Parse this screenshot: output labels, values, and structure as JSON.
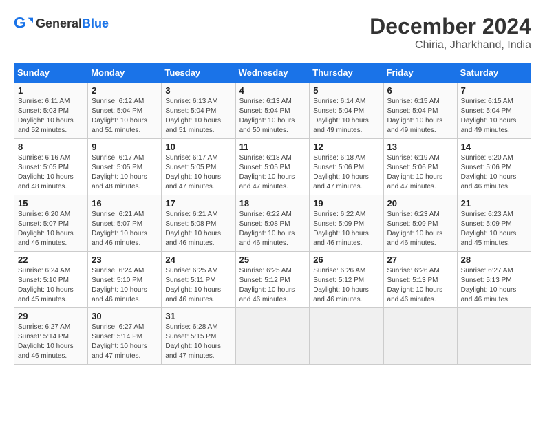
{
  "header": {
    "logo_general": "General",
    "logo_blue": "Blue",
    "main_title": "December 2024",
    "subtitle": "Chiria, Jharkhand, India"
  },
  "columns": [
    "Sunday",
    "Monday",
    "Tuesday",
    "Wednesday",
    "Thursday",
    "Friday",
    "Saturday"
  ],
  "weeks": [
    [
      {
        "day": "1",
        "info": "Sunrise: 6:11 AM\nSunset: 5:03 PM\nDaylight: 10 hours\nand 52 minutes."
      },
      {
        "day": "2",
        "info": "Sunrise: 6:12 AM\nSunset: 5:04 PM\nDaylight: 10 hours\nand 51 minutes."
      },
      {
        "day": "3",
        "info": "Sunrise: 6:13 AM\nSunset: 5:04 PM\nDaylight: 10 hours\nand 51 minutes."
      },
      {
        "day": "4",
        "info": "Sunrise: 6:13 AM\nSunset: 5:04 PM\nDaylight: 10 hours\nand 50 minutes."
      },
      {
        "day": "5",
        "info": "Sunrise: 6:14 AM\nSunset: 5:04 PM\nDaylight: 10 hours\nand 49 minutes."
      },
      {
        "day": "6",
        "info": "Sunrise: 6:15 AM\nSunset: 5:04 PM\nDaylight: 10 hours\nand 49 minutes."
      },
      {
        "day": "7",
        "info": "Sunrise: 6:15 AM\nSunset: 5:04 PM\nDaylight: 10 hours\nand 49 minutes."
      }
    ],
    [
      {
        "day": "8",
        "info": "Sunrise: 6:16 AM\nSunset: 5:05 PM\nDaylight: 10 hours\nand 48 minutes."
      },
      {
        "day": "9",
        "info": "Sunrise: 6:17 AM\nSunset: 5:05 PM\nDaylight: 10 hours\nand 48 minutes."
      },
      {
        "day": "10",
        "info": "Sunrise: 6:17 AM\nSunset: 5:05 PM\nDaylight: 10 hours\nand 47 minutes."
      },
      {
        "day": "11",
        "info": "Sunrise: 6:18 AM\nSunset: 5:05 PM\nDaylight: 10 hours\nand 47 minutes."
      },
      {
        "day": "12",
        "info": "Sunrise: 6:18 AM\nSunset: 5:06 PM\nDaylight: 10 hours\nand 47 minutes."
      },
      {
        "day": "13",
        "info": "Sunrise: 6:19 AM\nSunset: 5:06 PM\nDaylight: 10 hours\nand 47 minutes."
      },
      {
        "day": "14",
        "info": "Sunrise: 6:20 AM\nSunset: 5:06 PM\nDaylight: 10 hours\nand 46 minutes."
      }
    ],
    [
      {
        "day": "15",
        "info": "Sunrise: 6:20 AM\nSunset: 5:07 PM\nDaylight: 10 hours\nand 46 minutes."
      },
      {
        "day": "16",
        "info": "Sunrise: 6:21 AM\nSunset: 5:07 PM\nDaylight: 10 hours\nand 46 minutes."
      },
      {
        "day": "17",
        "info": "Sunrise: 6:21 AM\nSunset: 5:08 PM\nDaylight: 10 hours\nand 46 minutes."
      },
      {
        "day": "18",
        "info": "Sunrise: 6:22 AM\nSunset: 5:08 PM\nDaylight: 10 hours\nand 46 minutes."
      },
      {
        "day": "19",
        "info": "Sunrise: 6:22 AM\nSunset: 5:09 PM\nDaylight: 10 hours\nand 46 minutes."
      },
      {
        "day": "20",
        "info": "Sunrise: 6:23 AM\nSunset: 5:09 PM\nDaylight: 10 hours\nand 46 minutes."
      },
      {
        "day": "21",
        "info": "Sunrise: 6:23 AM\nSunset: 5:09 PM\nDaylight: 10 hours\nand 45 minutes."
      }
    ],
    [
      {
        "day": "22",
        "info": "Sunrise: 6:24 AM\nSunset: 5:10 PM\nDaylight: 10 hours\nand 45 minutes."
      },
      {
        "day": "23",
        "info": "Sunrise: 6:24 AM\nSunset: 5:10 PM\nDaylight: 10 hours\nand 46 minutes."
      },
      {
        "day": "24",
        "info": "Sunrise: 6:25 AM\nSunset: 5:11 PM\nDaylight: 10 hours\nand 46 minutes."
      },
      {
        "day": "25",
        "info": "Sunrise: 6:25 AM\nSunset: 5:12 PM\nDaylight: 10 hours\nand 46 minutes."
      },
      {
        "day": "26",
        "info": "Sunrise: 6:26 AM\nSunset: 5:12 PM\nDaylight: 10 hours\nand 46 minutes."
      },
      {
        "day": "27",
        "info": "Sunrise: 6:26 AM\nSunset: 5:13 PM\nDaylight: 10 hours\nand 46 minutes."
      },
      {
        "day": "28",
        "info": "Sunrise: 6:27 AM\nSunset: 5:13 PM\nDaylight: 10 hours\nand 46 minutes."
      }
    ],
    [
      {
        "day": "29",
        "info": "Sunrise: 6:27 AM\nSunset: 5:14 PM\nDaylight: 10 hours\nand 46 minutes."
      },
      {
        "day": "30",
        "info": "Sunrise: 6:27 AM\nSunset: 5:14 PM\nDaylight: 10 hours\nand 47 minutes."
      },
      {
        "day": "31",
        "info": "Sunrise: 6:28 AM\nSunset: 5:15 PM\nDaylight: 10 hours\nand 47 minutes."
      },
      {
        "day": "",
        "info": ""
      },
      {
        "day": "",
        "info": ""
      },
      {
        "day": "",
        "info": ""
      },
      {
        "day": "",
        "info": ""
      }
    ]
  ]
}
